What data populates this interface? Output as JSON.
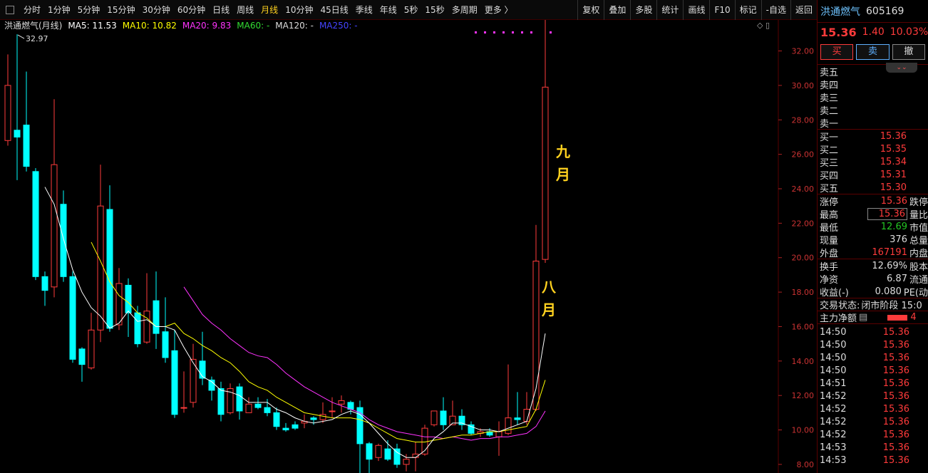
{
  "toolbar": {
    "periods": [
      "分时",
      "1分钟",
      "5分钟",
      "15分钟",
      "30分钟",
      "60分钟",
      "日线",
      "周线",
      "月线",
      "10分钟",
      "45日线",
      "季线",
      "年线",
      "5秒",
      "15秒",
      "多周期",
      "更多 〉"
    ],
    "active_index": 8,
    "right_buttons": [
      "复权",
      "叠加",
      "多股",
      "统计",
      "画线",
      "F10",
      "标记",
      "-自选",
      "返回"
    ]
  },
  "legend": {
    "title": "洪通燃气(月线)",
    "items": [
      {
        "label": "MA5: 11.53",
        "color": "#ffffff"
      },
      {
        "label": "MA10: 10.82",
        "color": "#ffff00"
      },
      {
        "label": "MA20: 9.83",
        "color": "#ff33ff"
      },
      {
        "label": "MA60: -",
        "color": "#33dd33"
      },
      {
        "label": "MA120: -",
        "color": "#dddddd"
      },
      {
        "label": "MA250: -",
        "color": "#4444ff"
      }
    ]
  },
  "annotations": {
    "high_label": "32.97",
    "sep_text": "九月",
    "aug_text": "八月"
  },
  "chart_data": {
    "type": "candlestick",
    "period": "monthly",
    "ylim": [
      7.5,
      33.8
    ],
    "yticks": [
      8,
      10,
      12,
      14,
      16,
      18,
      20,
      22,
      24,
      26,
      28,
      30,
      32
    ],
    "yticklabels": [
      "8.00",
      "10.00",
      "12.00",
      "14.00",
      "16.00",
      "18.00",
      "20.00",
      "22.00",
      "24.00",
      "26.00",
      "28.00",
      "30.00",
      "32.00"
    ],
    "candles": [
      [
        26.8,
        30.0,
        31.8,
        26.5
      ],
      [
        27.4,
        27.0,
        32.97,
        24.5
      ],
      [
        27.7,
        25.3,
        30.8,
        25.0
      ],
      [
        25.0,
        18.9,
        25.2,
        18.7
      ],
      [
        18.9,
        18.1,
        19.2,
        17.2
      ],
      [
        18.3,
        25.4,
        29.2,
        17.7
      ],
      [
        23.1,
        18.9,
        23.9,
        18.6
      ],
      [
        18.9,
        14.1,
        19.2,
        13.9
      ],
      [
        14.7,
        13.8,
        14.8,
        12.8
      ],
      [
        13.6,
        15.8,
        16.8,
        13.5
      ],
      [
        15.8,
        23.0,
        25.4,
        15.1
      ],
      [
        22.8,
        15.9,
        24.2,
        15.7
      ],
      [
        16.1,
        18.5,
        19.4,
        15.8
      ],
      [
        18.4,
        16.8,
        18.8,
        15.4
      ],
      [
        16.8,
        15.0,
        17.2,
        14.8
      ],
      [
        15.1,
        16.9,
        19.1,
        15.0
      ],
      [
        17.5,
        15.6,
        19.2,
        14.7
      ],
      [
        15.7,
        14.2,
        17.7,
        13.9
      ],
      [
        14.6,
        10.9,
        15.8,
        10.7
      ],
      [
        11.3,
        11.3,
        13.4,
        11.0
      ],
      [
        11.6,
        14.1,
        15.0,
        11.3
      ],
      [
        14.0,
        13.0,
        15.7,
        12.6
      ],
      [
        12.9,
        12.3,
        13.1,
        11.7
      ],
      [
        12.4,
        10.9,
        12.8,
        10.5
      ],
      [
        11.0,
        12.4,
        12.7,
        10.9
      ],
      [
        12.5,
        11.1,
        12.7,
        10.6
      ],
      [
        11.0,
        11.5,
        11.9,
        11.0
      ],
      [
        11.5,
        11.3,
        11.9,
        11.2
      ],
      [
        11.3,
        11.0,
        11.8,
        10.8
      ],
      [
        11.0,
        10.2,
        11.3,
        10.0
      ],
      [
        10.1,
        10.0,
        10.4,
        9.9
      ],
      [
        10.3,
        10.1,
        10.5,
        10.0
      ],
      [
        10.4,
        10.5,
        10.9,
        10.1
      ],
      [
        10.7,
        10.6,
        10.8,
        10.3
      ],
      [
        10.6,
        10.9,
        11.6,
        10.4
      ],
      [
        11.1,
        11.1,
        11.9,
        10.7
      ],
      [
        11.5,
        11.7,
        12.0,
        11.0
      ],
      [
        11.6,
        11.2,
        11.7,
        10.9
      ],
      [
        11.3,
        9.2,
        11.7,
        7.5
      ],
      [
        9.2,
        8.3,
        9.3,
        7.5
      ],
      [
        8.4,
        9.1,
        9.2,
        8.2
      ],
      [
        8.9,
        8.3,
        9.4,
        8.2
      ],
      [
        8.9,
        8.0,
        9.2,
        7.8
      ],
      [
        8.0,
        8.3,
        8.6,
        7.6
      ],
      [
        8.4,
        8.6,
        9.3,
        7.6
      ],
      [
        8.6,
        10.1,
        10.3,
        8.5
      ],
      [
        10.3,
        11.1,
        10.3,
        10.2
      ],
      [
        11.1,
        10.3,
        11.9,
        10.0
      ],
      [
        10.3,
        10.8,
        11.7,
        10.5
      ],
      [
        10.8,
        10.3,
        11.2,
        10.0
      ],
      [
        10.3,
        9.8,
        10.5,
        9.7
      ],
      [
        9.8,
        9.9,
        10.1,
        9.6
      ],
      [
        9.9,
        9.7,
        10.1,
        9.6
      ],
      [
        9.6,
        9.9,
        10.5,
        8.5
      ],
      [
        9.8,
        10.7,
        13.8,
        9.7
      ],
      [
        10.7,
        10.6,
        12.2,
        10.3
      ],
      [
        10.5,
        11.2,
        12.2,
        10.3
      ],
      [
        11.2,
        19.8,
        21.9,
        11.1
      ],
      [
        19.9,
        29.9,
        33.8,
        19.7
      ]
    ],
    "ma5": [
      null,
      null,
      null,
      null,
      24.1,
      23.1,
      21.1,
      19.3,
      18.0,
      17.1,
      16.6,
      15.9,
      16.2,
      16.9,
      16.3,
      16.4,
      16.0,
      16.0,
      15.8,
      14.8,
      13.9,
      13.1,
      12.8,
      12.3,
      12.2,
      12.0,
      11.6,
      11.6,
      11.6,
      11.2,
      11.0,
      10.7,
      10.5,
      10.4,
      10.5,
      10.6,
      10.9,
      11.1,
      10.9,
      10.4,
      9.8,
      9.2,
      8.7,
      8.4,
      8.4,
      8.8,
      9.5,
      9.9,
      10.4,
      10.4,
      10.2,
      10.0,
      10.0,
      9.9,
      10.1,
      10.3,
      10.5,
      12.4,
      15.6
    ],
    "ma10": [
      null,
      null,
      null,
      null,
      null,
      null,
      null,
      null,
      null,
      20.9,
      19.8,
      18.6,
      17.8,
      17.4,
      16.8,
      16.5,
      16.0,
      16.0,
      16.2,
      15.6,
      15.3,
      14.9,
      14.6,
      14.2,
      13.9,
      13.4,
      12.8,
      12.5,
      12.3,
      11.9,
      11.6,
      11.3,
      11.0,
      10.9,
      10.8,
      10.7,
      10.7,
      10.7,
      10.6,
      10.4,
      10.1,
      9.8,
      9.5,
      9.4,
      9.3,
      9.3,
      9.4,
      9.5,
      9.6,
      9.7,
      9.7,
      9.8,
      9.9,
      9.9,
      10.0,
      10.1,
      10.2,
      11.2,
      12.9
    ],
    "ma20": [
      null,
      null,
      null,
      null,
      null,
      null,
      null,
      null,
      null,
      null,
      null,
      null,
      null,
      null,
      null,
      null,
      null,
      null,
      null,
      18.3,
      17.5,
      16.7,
      16.2,
      15.8,
      15.3,
      14.9,
      14.5,
      14.3,
      14.2,
      13.8,
      13.3,
      12.9,
      12.5,
      12.2,
      11.9,
      11.6,
      11.4,
      11.2,
      11.0,
      10.6,
      10.3,
      10.1,
      9.9,
      9.8,
      9.7,
      9.6,
      9.6,
      9.5,
      9.6,
      9.5,
      9.4,
      9.5,
      9.5,
      9.6,
      9.6,
      9.7,
      9.8,
      10.2,
      11.1
    ]
  },
  "panel": {
    "name": "洪通燃气",
    "code": "605169",
    "price": "15.36",
    "change": "1.40",
    "change_pct": "10.03%",
    "buy_btn": "买",
    "sell_btn": "卖",
    "cancel_btn": "撤",
    "asks": [
      {
        "label": "卖五",
        "value": ""
      },
      {
        "label": "卖四",
        "value": ""
      },
      {
        "label": "卖三",
        "value": ""
      },
      {
        "label": "卖二",
        "value": ""
      },
      {
        "label": "卖一",
        "value": ""
      }
    ],
    "bids": [
      {
        "label": "买一",
        "value": "15.36"
      },
      {
        "label": "买二",
        "value": "15.35"
      },
      {
        "label": "买三",
        "value": "15.34"
      },
      {
        "label": "买四",
        "value": "15.31"
      },
      {
        "label": "买五",
        "value": "15.30"
      }
    ],
    "stats1": [
      {
        "label": "涨停",
        "value": "15.36",
        "cls": "red",
        "label2": "跌停"
      },
      {
        "label": "最高",
        "value": "15.36",
        "cls": "red boxed",
        "label2": "量比"
      },
      {
        "label": "最低",
        "value": "12.69",
        "cls": "green",
        "label2": "市值"
      },
      {
        "label": "现量",
        "value": "376",
        "cls": "white",
        "label2": "总量"
      },
      {
        "label": "外盘",
        "value": "167191",
        "cls": "red",
        "label2": "内盘"
      }
    ],
    "stats2": [
      {
        "label": "换手",
        "value": "12.69%",
        "cls": "white",
        "label2": "股本"
      },
      {
        "label": "净资",
        "value": "6.87",
        "cls": "white",
        "label2": "流通"
      },
      {
        "label": "收益(-)",
        "value": "0.080",
        "cls": "white",
        "label2": "PE(动"
      }
    ],
    "trade_state_label": "交易状态:",
    "trade_state_value": "闭市阶段 15:0",
    "flow_label": "主力净额",
    "flow_value": "4",
    "ticks": [
      {
        "time": "14:50",
        "price": "15.36"
      },
      {
        "time": "14:50",
        "price": "15.36"
      },
      {
        "time": "14:50",
        "price": "15.36"
      },
      {
        "time": "14:50",
        "price": "15.36"
      },
      {
        "time": "14:51",
        "price": "15.36"
      },
      {
        "time": "14:52",
        "price": "15.36"
      },
      {
        "time": "14:52",
        "price": "15.36"
      },
      {
        "time": "14:52",
        "price": "15.36"
      },
      {
        "time": "14:52",
        "price": "15.36"
      },
      {
        "time": "14:53",
        "price": "15.36"
      },
      {
        "time": "14:53",
        "price": "15.36"
      }
    ]
  },
  "colors": {
    "up": "#ff3b3b",
    "down": "#00ffff",
    "ma5": "#ffffff",
    "ma10": "#ffff00",
    "ma20": "#ff33ff",
    "label_yellow": "#ffd21f",
    "grid": "#3a0000"
  }
}
